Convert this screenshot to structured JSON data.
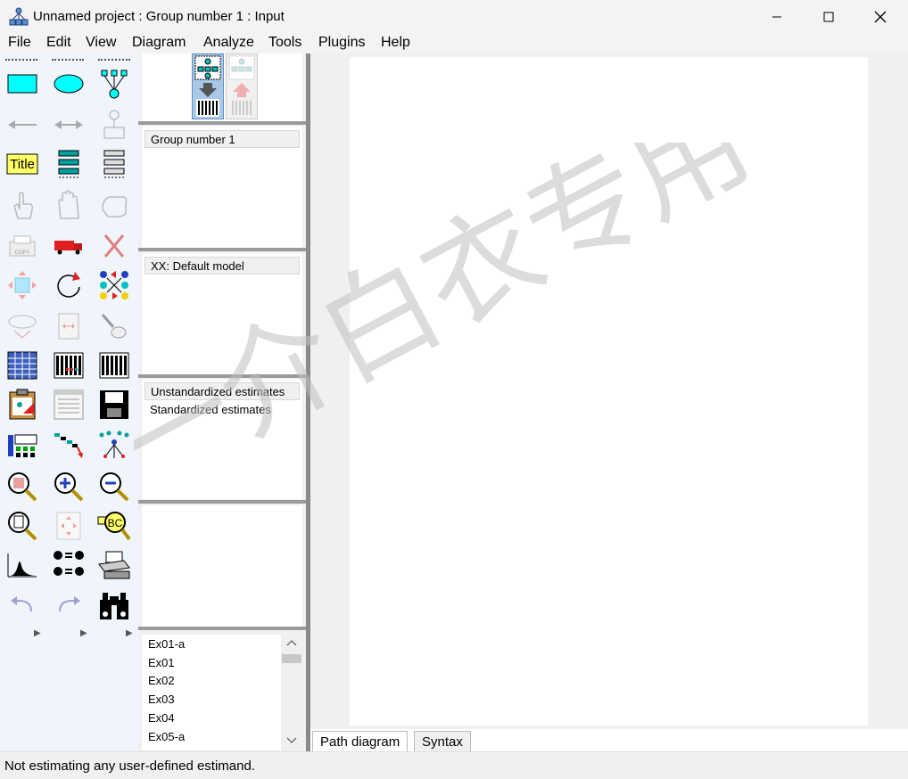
{
  "window": {
    "title": "Unnamed project : Group number 1 : Input",
    "controls": [
      "minimize",
      "maximize",
      "close"
    ]
  },
  "menu": [
    "File",
    "Edit",
    "View",
    "Diagram",
    "Analyze",
    "Tools",
    "Plugins",
    "Help"
  ],
  "toolbox": {
    "icons": [
      "rectangle-icon",
      "ellipse-icon",
      "indicator-icon",
      "single-arrow-icon",
      "double-arrow-icon",
      "unique-variable-icon",
      "title-icon",
      "list-variables-model-icon",
      "list-variables-dataset-icon",
      "select-one-icon",
      "select-all-icon",
      "deselect-all-icon",
      "duplicate-icon",
      "move-icon",
      "erase-icon",
      "change-shape-icon",
      "rotate-icon",
      "reflect-icon",
      "move-parameter-icon",
      "scroll-icon",
      "touch-up-icon",
      "data-files-icon",
      "analysis-properties-icon",
      "calculate-estimates-icon",
      "clipboard-icon",
      "text-output-icon",
      "save-icon",
      "object-properties-icon",
      "drag-properties-icon",
      "preserve-symmetries-icon",
      "zoom-select-icon",
      "zoom-in-icon",
      "zoom-out-icon",
      "zoom-page-icon",
      "fit-page-icon",
      "loupe-icon",
      "bayesian-icon",
      "multiple-group-icon",
      "print-icon",
      "undo-icon",
      "redo-icon",
      "specification-search-icon"
    ],
    "title_label": "Title"
  },
  "view_toggle": [
    "input-path-diagram-icon",
    "output-path-diagram-icon"
  ],
  "panels": {
    "groups": [
      "Group number 1"
    ],
    "models": [
      "XX: Default model"
    ],
    "estimates": [
      "Unstandardized estimates",
      "Standardized estimates"
    ],
    "files": [
      "Ex01-a",
      "Ex01",
      "Ex02",
      "Ex03",
      "Ex04",
      "Ex05-a"
    ]
  },
  "tabs": [
    "Path diagram",
    "Syntax"
  ],
  "status": "Not estimating any user-defined estimand.",
  "watermark": "一介白衣专用",
  "colors": {
    "cyan": "#00ffff",
    "title_yellow": "#ffff66",
    "accent_red": "#e02020"
  }
}
